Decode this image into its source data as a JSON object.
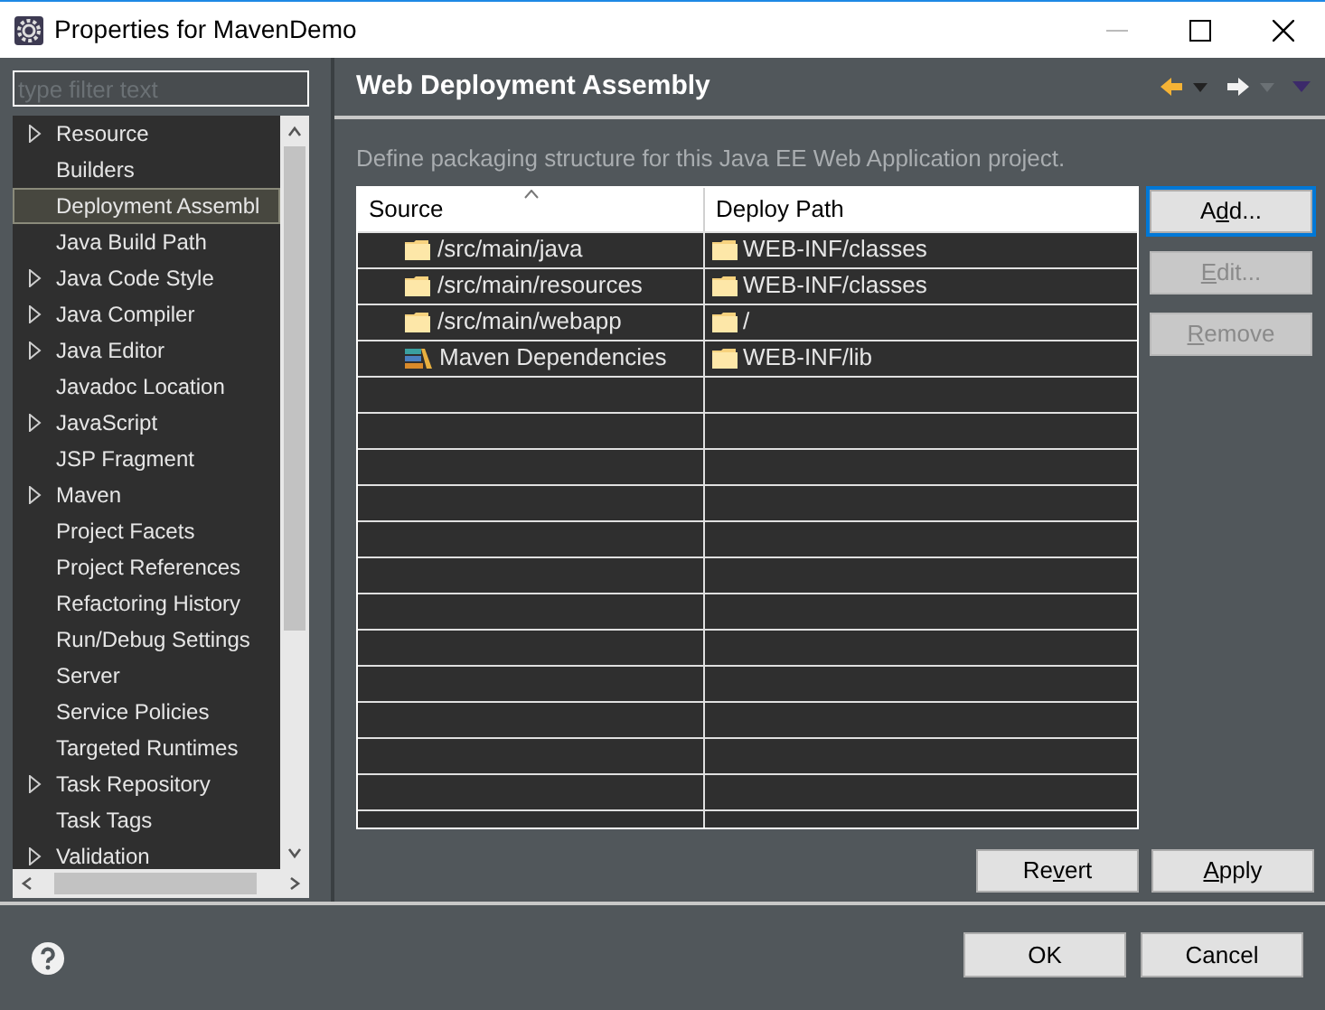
{
  "window": {
    "title": "Properties for MavenDemo"
  },
  "filter": {
    "placeholder": "type filter text"
  },
  "sidebar": {
    "items": [
      {
        "label": "Resource",
        "expandable": true,
        "selected": false
      },
      {
        "label": "Builders",
        "expandable": false,
        "selected": false
      },
      {
        "label": "Deployment Assembl",
        "expandable": false,
        "selected": true
      },
      {
        "label": "Java Build Path",
        "expandable": false,
        "selected": false
      },
      {
        "label": "Java Code Style",
        "expandable": true,
        "selected": false
      },
      {
        "label": "Java Compiler",
        "expandable": true,
        "selected": false
      },
      {
        "label": "Java Editor",
        "expandable": true,
        "selected": false
      },
      {
        "label": "Javadoc Location",
        "expandable": false,
        "selected": false
      },
      {
        "label": "JavaScript",
        "expandable": true,
        "selected": false
      },
      {
        "label": "JSP Fragment",
        "expandable": false,
        "selected": false
      },
      {
        "label": "Maven",
        "expandable": true,
        "selected": false
      },
      {
        "label": "Project Facets",
        "expandable": false,
        "selected": false
      },
      {
        "label": "Project References",
        "expandable": false,
        "selected": false
      },
      {
        "label": "Refactoring History",
        "expandable": false,
        "selected": false
      },
      {
        "label": "Run/Debug Settings",
        "expandable": false,
        "selected": false
      },
      {
        "label": "Server",
        "expandable": false,
        "selected": false
      },
      {
        "label": "Service Policies",
        "expandable": false,
        "selected": false
      },
      {
        "label": "Targeted Runtimes",
        "expandable": false,
        "selected": false
      },
      {
        "label": "Task Repository",
        "expandable": true,
        "selected": false
      },
      {
        "label": "Task Tags",
        "expandable": false,
        "selected": false
      },
      {
        "label": "Validation",
        "expandable": true,
        "selected": false
      }
    ]
  },
  "page": {
    "title": "Web Deployment Assembly",
    "description": "Define packaging structure for this Java EE Web Application project."
  },
  "table": {
    "columns": [
      "Source",
      "Deploy Path"
    ],
    "rows": [
      {
        "source": "/src/main/java",
        "kind": "folder",
        "deploy_path": "WEB-INF/classes"
      },
      {
        "source": "/src/main/resources",
        "kind": "folder",
        "deploy_path": "WEB-INF/classes"
      },
      {
        "source": "/src/main/webapp",
        "kind": "folder",
        "deploy_path": "/"
      },
      {
        "source": "Maven Dependencies",
        "kind": "library",
        "deploy_path": "WEB-INF/lib"
      }
    ]
  },
  "side_buttons": [
    {
      "label_before": "A",
      "mnemonic": "d",
      "label_after": "d...",
      "disabled": false,
      "focused": true
    },
    {
      "mnemonic": "E",
      "label_after": "dit...",
      "disabled": true,
      "focused": false
    },
    {
      "mnemonic": "R",
      "label_after": "emove",
      "disabled": true,
      "focused": false
    }
  ],
  "page_buttons": [
    {
      "label_before": "Re",
      "mnemonic": "v",
      "label_after": "ert"
    },
    {
      "mnemonic": "A",
      "label_after": "pply"
    }
  ],
  "dialog_buttons": [
    "OK",
    "Cancel"
  ]
}
